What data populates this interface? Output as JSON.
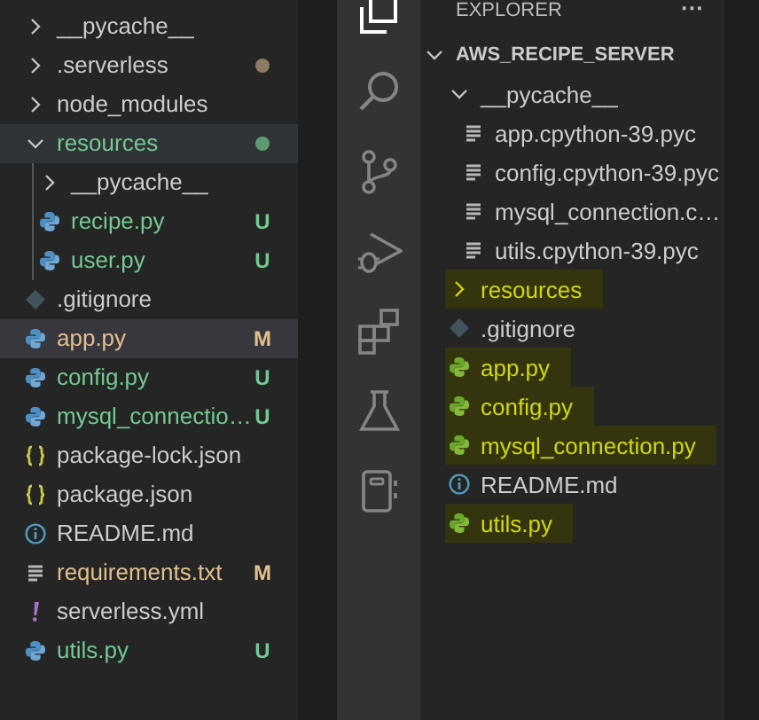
{
  "left_explorer": {
    "items": [
      {
        "name": "__pycache__",
        "kind": "folder",
        "expanded": false,
        "selected": false,
        "hovered": false
      },
      {
        "name": ".serverless",
        "kind": "folder",
        "expanded": false,
        "selected": false,
        "hovered": false,
        "dot": {
          "color": "#8c7b65"
        }
      },
      {
        "name": "node_modules",
        "kind": "folder",
        "expanded": false,
        "selected": false,
        "hovered": false
      },
      {
        "name": "resources",
        "kind": "folder",
        "expanded": true,
        "selected": false,
        "hovered": true,
        "color": "#73c991",
        "dot": {
          "color": "#5d9c73"
        },
        "children": [
          {
            "name": "__pycache__",
            "kind": "folder",
            "expanded": false,
            "selected": false,
            "hovered": false
          },
          {
            "name": "recipe.py",
            "kind": "python",
            "selected": false,
            "hovered": false,
            "color": "#73c991",
            "status": "U"
          },
          {
            "name": "user.py",
            "kind": "python",
            "selected": false,
            "hovered": false,
            "color": "#73c991",
            "status": "U"
          }
        ]
      },
      {
        "name": ".gitignore",
        "kind": "git",
        "selected": false,
        "hovered": false
      },
      {
        "name": "app.py",
        "kind": "python",
        "selected": true,
        "hovered": false,
        "color": "#e2c08d",
        "status": "M"
      },
      {
        "name": "config.py",
        "kind": "python",
        "selected": false,
        "hovered": false,
        "color": "#73c991",
        "status": "U"
      },
      {
        "name": "mysql_connectio…",
        "kind": "python",
        "selected": false,
        "hovered": false,
        "color": "#73c991",
        "status": "U"
      },
      {
        "name": "package-lock.json",
        "kind": "json",
        "selected": false,
        "hovered": false
      },
      {
        "name": "package.json",
        "kind": "json",
        "selected": false,
        "hovered": false
      },
      {
        "name": "README.md",
        "kind": "info",
        "selected": false,
        "hovered": false
      },
      {
        "name": "requirements.txt",
        "kind": "text",
        "selected": false,
        "hovered": false,
        "color": "#e2c08d",
        "status": "M"
      },
      {
        "name": "serverless.yml",
        "kind": "yaml",
        "selected": false,
        "hovered": false
      },
      {
        "name": "utils.py",
        "kind": "python",
        "selected": false,
        "hovered": false,
        "color": "#73c991",
        "status": "U"
      }
    ]
  },
  "right_explorer": {
    "title": "EXPLORER",
    "more": "···",
    "root": {
      "name": "AWS_RECIPE_SERVER",
      "expanded": true,
      "children": [
        {
          "name": "__pycache__",
          "kind": "folder",
          "expanded": true,
          "highlighted": false,
          "children": [
            {
              "name": "app.cpython-39.pyc",
              "kind": "text",
              "highlighted": false
            },
            {
              "name": "config.cpython-39.pyc",
              "kind": "text",
              "highlighted": false
            },
            {
              "name": "mysql_connection.c…",
              "kind": "text",
              "highlighted": false
            },
            {
              "name": "utils.cpython-39.pyc",
              "kind": "text",
              "highlighted": false
            }
          ]
        },
        {
          "name": "resources",
          "kind": "folder",
          "expanded": false,
          "highlighted": true
        },
        {
          "name": ".gitignore",
          "kind": "git",
          "highlighted": false
        },
        {
          "name": "app.py",
          "kind": "python",
          "highlighted": true
        },
        {
          "name": "config.py",
          "kind": "python",
          "highlighted": true
        },
        {
          "name": "mysql_connection.py",
          "kind": "python",
          "highlighted": true
        },
        {
          "name": "README.md",
          "kind": "info",
          "highlighted": false
        },
        {
          "name": "utils.py",
          "kind": "python",
          "highlighted": true
        }
      ]
    }
  }
}
